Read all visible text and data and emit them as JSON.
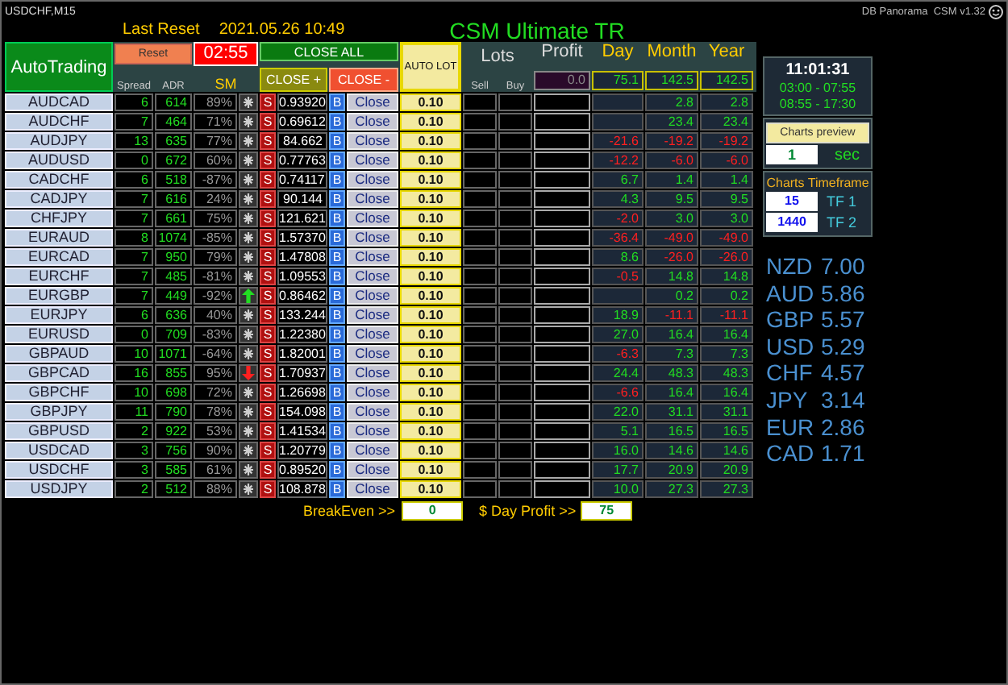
{
  "window": {
    "title": "USDCHF,M15",
    "indicator": "DB Panorama  CSM v1.32"
  },
  "header": {
    "last_reset_label": "Last Reset",
    "last_reset": "2021.05.26 10:49",
    "title": "CSM Ultimate TR"
  },
  "controls": {
    "auto_trading": "AutoTrading",
    "reset": "Reset",
    "timer": "02:55",
    "close_all": "CLOSE ALL",
    "close_plus": "CLOSE +",
    "close_minus": "CLOSE -",
    "auto_lot": "AUTO LOT"
  },
  "columns": {
    "spread": "Spread",
    "adr": "ADR",
    "sm": "SM",
    "lots": "Lots",
    "sell": "Sell",
    "buy": "Buy",
    "profit": "Profit",
    "day": "Day",
    "month": "Month",
    "year": "Year"
  },
  "totals": {
    "profit": "0.0",
    "day": "75.1",
    "month": "142.5",
    "year": "142.5"
  },
  "rows": [
    {
      "pair": "AUDCAD",
      "spread": "6",
      "adr": "614",
      "sm": "89%",
      "signal": {
        "kind": "none"
      },
      "sell": "S",
      "price": "0.93920",
      "buy": "B",
      "close": "Close",
      "lot": "0.10",
      "month": {
        "value": "2.8",
        "negative": false
      },
      "year": {
        "value": "2.8",
        "negative": false
      }
    },
    {
      "pair": "AUDCHF",
      "spread": "7",
      "adr": "464",
      "sm": "71%",
      "signal": {
        "kind": "none"
      },
      "sell": "S",
      "price": "0.69612",
      "buy": "B",
      "close": "Close",
      "lot": "0.10",
      "month": {
        "value": "23.4",
        "negative": false
      },
      "year": {
        "value": "23.4",
        "negative": false
      }
    },
    {
      "pair": "AUDJPY",
      "spread": "13",
      "adr": "635",
      "sm": "77%",
      "signal": {
        "kind": "none"
      },
      "sell": "S",
      "price": "84.662",
      "buy": "B",
      "close": "Close",
      "lot": "0.10",
      "day": {
        "value": "-21.6",
        "negative": true
      },
      "month": {
        "value": "-19.2",
        "negative": true
      },
      "year": {
        "value": "-19.2",
        "negative": true
      }
    },
    {
      "pair": "AUDUSD",
      "spread": "0",
      "adr": "672",
      "sm": "60%",
      "signal": {
        "kind": "none"
      },
      "sell": "S",
      "price": "0.77763",
      "buy": "B",
      "close": "Close",
      "lot": "0.10",
      "day": {
        "value": "-12.2",
        "negative": true
      },
      "month": {
        "value": "-6.0",
        "negative": true
      },
      "year": {
        "value": "-6.0",
        "negative": true
      }
    },
    {
      "pair": "CADCHF",
      "spread": "6",
      "adr": "518",
      "sm": "-87%",
      "signal": {
        "kind": "none"
      },
      "sell": "S",
      "price": "0.74117",
      "buy": "B",
      "close": "Close",
      "lot": "0.10",
      "day": {
        "value": "6.7",
        "negative": false
      },
      "month": {
        "value": "1.4",
        "negative": false
      },
      "year": {
        "value": "1.4",
        "negative": false
      }
    },
    {
      "pair": "CADJPY",
      "spread": "7",
      "adr": "616",
      "sm": "24%",
      "signal": {
        "kind": "none"
      },
      "sell": "S",
      "price": "90.144",
      "buy": "B",
      "close": "Close",
      "lot": "0.10",
      "day": {
        "value": "4.3",
        "negative": false
      },
      "month": {
        "value": "9.5",
        "negative": false
      },
      "year": {
        "value": "9.5",
        "negative": false
      }
    },
    {
      "pair": "CHFJPY",
      "spread": "7",
      "adr": "661",
      "sm": "75%",
      "signal": {
        "kind": "none"
      },
      "sell": "S",
      "price": "121.621",
      "buy": "B",
      "close": "Close",
      "lot": "0.10",
      "day": {
        "value": "-2.0",
        "negative": true
      },
      "month": {
        "value": "3.0",
        "negative": false
      },
      "year": {
        "value": "3.0",
        "negative": false
      }
    },
    {
      "pair": "EURAUD",
      "spread": "8",
      "adr": "1074",
      "sm": "-85%",
      "signal": {
        "kind": "none"
      },
      "sell": "S",
      "price": "1.57370",
      "buy": "B",
      "close": "Close",
      "lot": "0.10",
      "day": {
        "value": "-36.4",
        "negative": true
      },
      "month": {
        "value": "-49.0",
        "negative": true
      },
      "year": {
        "value": "-49.0",
        "negative": true
      }
    },
    {
      "pair": "EURCAD",
      "spread": "7",
      "adr": "950",
      "sm": "79%",
      "signal": {
        "kind": "none"
      },
      "sell": "S",
      "price": "1.47808",
      "buy": "B",
      "close": "Close",
      "lot": "0.10",
      "day": {
        "value": "8.6",
        "negative": false
      },
      "month": {
        "value": "-26.0",
        "negative": true
      },
      "year": {
        "value": "-26.0",
        "negative": true
      }
    },
    {
      "pair": "EURCHF",
      "spread": "7",
      "adr": "485",
      "sm": "-81%",
      "signal": {
        "kind": "none"
      },
      "sell": "S",
      "price": "1.09553",
      "buy": "B",
      "close": "Close",
      "lot": "0.10",
      "day": {
        "value": "-0.5",
        "negative": true
      },
      "month": {
        "value": "14.8",
        "negative": false
      },
      "year": {
        "value": "14.8",
        "negative": false
      }
    },
    {
      "pair": "EURGBP",
      "spread": "7",
      "adr": "449",
      "sm": "-92%",
      "signal": {
        "kind": "up"
      },
      "sell": "S",
      "price": "0.86462",
      "buy": "B",
      "close": "Close",
      "lot": "0.10",
      "month": {
        "value": "0.2",
        "negative": false
      },
      "year": {
        "value": "0.2",
        "negative": false
      }
    },
    {
      "pair": "EURJPY",
      "spread": "6",
      "adr": "636",
      "sm": "40%",
      "signal": {
        "kind": "none"
      },
      "sell": "S",
      "price": "133.244",
      "buy": "B",
      "close": "Close",
      "lot": "0.10",
      "day": {
        "value": "18.9",
        "negative": false
      },
      "month": {
        "value": "-11.1",
        "negative": true
      },
      "year": {
        "value": "-11.1",
        "negative": true
      }
    },
    {
      "pair": "EURUSD",
      "spread": "0",
      "adr": "709",
      "sm": "-83%",
      "signal": {
        "kind": "none"
      },
      "sell": "S",
      "price": "1.22380",
      "buy": "B",
      "close": "Close",
      "lot": "0.10",
      "day": {
        "value": "27.0",
        "negative": false
      },
      "month": {
        "value": "16.4",
        "negative": false
      },
      "year": {
        "value": "16.4",
        "negative": false
      }
    },
    {
      "pair": "GBPAUD",
      "spread": "10",
      "adr": "1071",
      "sm": "-64%",
      "signal": {
        "kind": "none"
      },
      "sell": "S",
      "price": "1.82001",
      "buy": "B",
      "close": "Close",
      "lot": "0.10",
      "day": {
        "value": "-6.3",
        "negative": true
      },
      "month": {
        "value": "7.3",
        "negative": false
      },
      "year": {
        "value": "7.3",
        "negative": false
      }
    },
    {
      "pair": "GBPCAD",
      "spread": "16",
      "adr": "855",
      "sm": "95%",
      "signal": {
        "kind": "down"
      },
      "sell": "S",
      "price": "1.70937",
      "buy": "B",
      "close": "Close",
      "lot": "0.10",
      "day": {
        "value": "24.4",
        "negative": false
      },
      "month": {
        "value": "48.3",
        "negative": false
      },
      "year": {
        "value": "48.3",
        "negative": false
      }
    },
    {
      "pair": "GBPCHF",
      "spread": "10",
      "adr": "698",
      "sm": "72%",
      "signal": {
        "kind": "none"
      },
      "sell": "S",
      "price": "1.26698",
      "buy": "B",
      "close": "Close",
      "lot": "0.10",
      "day": {
        "value": "-6.6",
        "negative": true
      },
      "month": {
        "value": "16.4",
        "negative": false
      },
      "year": {
        "value": "16.4",
        "negative": false
      }
    },
    {
      "pair": "GBPJPY",
      "spread": "11",
      "adr": "790",
      "sm": "78%",
      "signal": {
        "kind": "none"
      },
      "sell": "S",
      "price": "154.098",
      "buy": "B",
      "close": "Close",
      "lot": "0.10",
      "day": {
        "value": "22.0",
        "negative": false
      },
      "month": {
        "value": "31.1",
        "negative": false
      },
      "year": {
        "value": "31.1",
        "negative": false
      }
    },
    {
      "pair": "GBPUSD",
      "spread": "2",
      "adr": "922",
      "sm": "53%",
      "signal": {
        "kind": "none"
      },
      "sell": "S",
      "price": "1.41534",
      "buy": "B",
      "close": "Close",
      "lot": "0.10",
      "day": {
        "value": "5.1",
        "negative": false
      },
      "month": {
        "value": "16.5",
        "negative": false
      },
      "year": {
        "value": "16.5",
        "negative": false
      }
    },
    {
      "pair": "USDCAD",
      "spread": "3",
      "adr": "756",
      "sm": "90%",
      "signal": {
        "kind": "none"
      },
      "sell": "S",
      "price": "1.20779",
      "buy": "B",
      "close": "Close",
      "lot": "0.10",
      "day": {
        "value": "16.0",
        "negative": false
      },
      "month": {
        "value": "14.6",
        "negative": false
      },
      "year": {
        "value": "14.6",
        "negative": false
      }
    },
    {
      "pair": "USDCHF",
      "spread": "3",
      "adr": "585",
      "sm": "61%",
      "signal": {
        "kind": "none"
      },
      "sell": "S",
      "price": "0.89520",
      "buy": "B",
      "close": "Close",
      "lot": "0.10",
      "day": {
        "value": "17.7",
        "negative": false
      },
      "month": {
        "value": "20.9",
        "negative": false
      },
      "year": {
        "value": "20.9",
        "negative": false
      }
    },
    {
      "pair": "USDJPY",
      "spread": "2",
      "adr": "512",
      "sm": "88%",
      "signal": {
        "kind": "none"
      },
      "sell": "S",
      "price": "108.878",
      "buy": "B",
      "close": "Close",
      "lot": "0.10",
      "day": {
        "value": "10.0",
        "negative": false
      },
      "month": {
        "value": "27.3",
        "negative": false
      },
      "year": {
        "value": "27.3",
        "negative": false
      }
    }
  ],
  "footer": {
    "breakeven_label": "BreakEven >>",
    "breakeven": "0",
    "day_profit_label": "$ Day Profit >>",
    "day_profit": "75"
  },
  "side_panel": {
    "clock": "11:01:31",
    "sessions": [
      "03:00 - 07:55",
      "08:55 - 17:30"
    ],
    "charts_preview": "Charts preview",
    "preview_seconds": "1",
    "seconds_unit": "sec",
    "timeframe_title": "Charts Timeframe",
    "timeframes": [
      {
        "value": "15",
        "label": "TF 1"
      },
      {
        "value": "1440",
        "label": "TF 2"
      }
    ]
  },
  "strength": [
    {
      "currency": "NZD",
      "value": "7.00"
    },
    {
      "currency": "AUD",
      "value": "5.86"
    },
    {
      "currency": "GBP",
      "value": "5.57"
    },
    {
      "currency": "USD",
      "value": "5.29"
    },
    {
      "currency": "CHF",
      "value": "4.57"
    },
    {
      "currency": "JPY",
      "value": "3.14"
    },
    {
      "currency": "EUR",
      "value": "2.86"
    },
    {
      "currency": "CAD",
      "value": "1.71"
    }
  ]
}
